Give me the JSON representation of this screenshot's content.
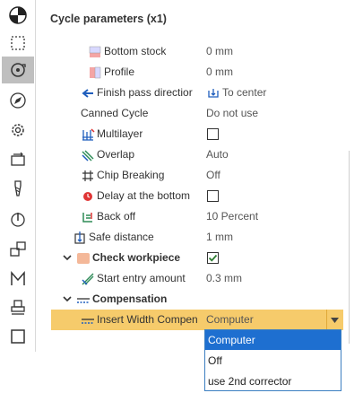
{
  "toolbar": {
    "tools": [
      {
        "icon": "stock-pie-icon"
      },
      {
        "icon": "dashed-rectangle-icon"
      },
      {
        "icon": "cycle-icon",
        "active": true
      },
      {
        "icon": "compass-icon"
      },
      {
        "icon": "gear-icon"
      },
      {
        "icon": "tool-change-icon"
      },
      {
        "icon": "drill-bit-icon"
      },
      {
        "icon": "spindle-icon"
      },
      {
        "icon": "stacked-blocks-icon"
      },
      {
        "icon": "m-code-icon"
      },
      {
        "icon": "stamp-icon"
      },
      {
        "icon": "square-icon"
      }
    ]
  },
  "panel": {
    "title": "Cycle parameters (x1)",
    "rows": {
      "bottom_stock": {
        "label": "Bottom stock",
        "value": "0 mm"
      },
      "profile": {
        "label": "Profile",
        "value": "0 mm"
      },
      "finish_pass": {
        "label": "Finish pass directior",
        "value": "To center"
      },
      "canned_cycle": {
        "label": "Canned Cycle",
        "value": "Do not use"
      },
      "multilayer": {
        "label": "Multilayer",
        "checked": false
      },
      "overlap": {
        "label": "Overlap",
        "value": "Auto"
      },
      "chip_breaking": {
        "label": "Chip Breaking",
        "value": "Off"
      },
      "delay_bottom": {
        "label": "Delay at the bottom",
        "checked": false
      },
      "back_off": {
        "label": "Back off",
        "value": "10 Percent"
      },
      "safe_distance": {
        "label": "Safe distance",
        "value": "1 mm"
      },
      "check_workpiece": {
        "label": "Check workpiece",
        "checked": true
      },
      "start_entry": {
        "label": "Start entry amount",
        "value": "0.3 mm"
      },
      "compensation": {
        "label": "Compensation"
      },
      "insert_width": {
        "label": "Insert Width Compen",
        "value": "Computer"
      }
    }
  },
  "dropdown": {
    "options": [
      "Computer",
      "Off",
      "use 2nd corrector"
    ],
    "selected": "Computer"
  },
  "colors": {
    "highlight": "#f6cb6b",
    "selection": "#1e6fd0",
    "checkbox_check": "#2e7d32",
    "workpiece_swatch": "#f4b899"
  }
}
